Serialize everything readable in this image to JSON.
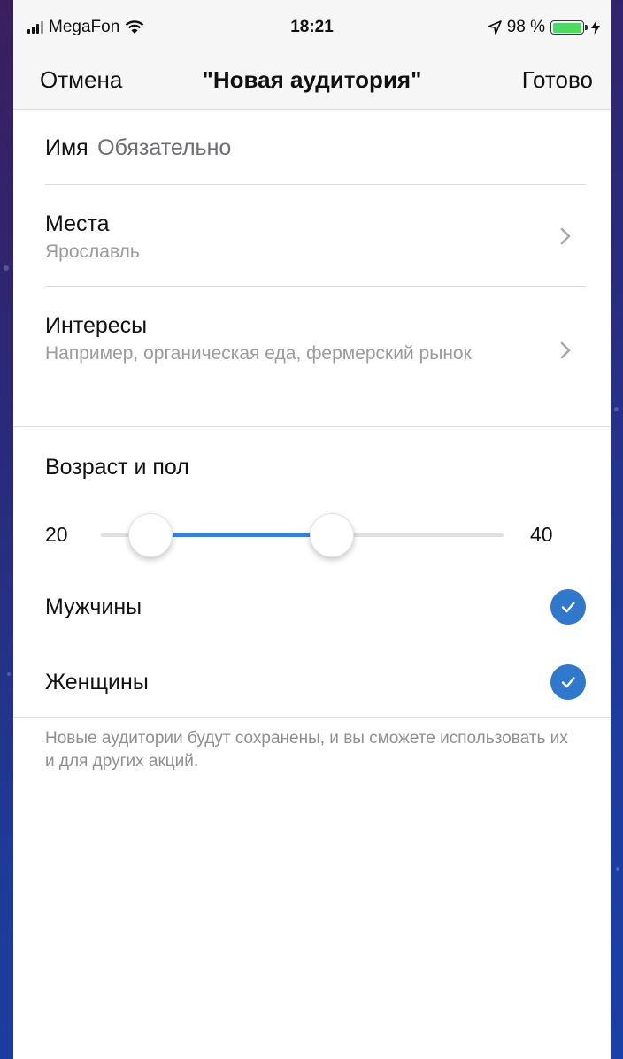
{
  "status_bar": {
    "carrier": "MegaFon",
    "time": "18:21",
    "battery_text": "98 %",
    "battery_level": 0.98,
    "icons": [
      "signal-icon",
      "wifi-icon",
      "location-icon",
      "battery-icon",
      "charging-icon"
    ]
  },
  "nav": {
    "cancel_label": "Отмена",
    "title": "\"Новая аудитория\"",
    "done_label": "Готово"
  },
  "form": {
    "name_label": "Имя",
    "name_placeholder": "Обязательно",
    "places_label": "Места",
    "places_value": "Ярославль",
    "interests_label": "Интересы",
    "interests_placeholder": "Например, органическая еда, фермерский рынок"
  },
  "age_gender": {
    "section_title": "Возраст и пол",
    "age_min": "20",
    "age_max": "40",
    "men_label": "Мужчины",
    "men_checked": true,
    "women_label": "Женщины",
    "women_checked": true
  },
  "footer_note": "Новые аудитории будут сохранены, и вы сможете использовать их и для других акций.",
  "colors": {
    "accent": "#3d7fd6",
    "check_bg": "#2f78cc",
    "slider_track": "#e0e0e3",
    "battery": "#4cd964"
  }
}
